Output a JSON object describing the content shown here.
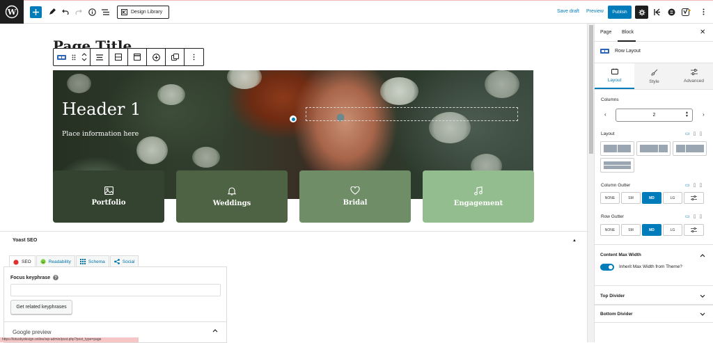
{
  "topbar": {
    "design_library_label": "Design Library",
    "save_draft_label": "Save draft",
    "preview_label": "Preview",
    "publish_label": "Publish"
  },
  "canvas": {
    "post_title": "Page Title",
    "hero": {
      "heading": "Header 1",
      "text": "Place information here"
    },
    "cards": [
      {
        "label": "Portfolio",
        "icon": "image-icon",
        "color": "#344330"
      },
      {
        "label": "Weddings",
        "icon": "bell-icon",
        "color": "#4d6343"
      },
      {
        "label": "Bridal",
        "icon": "heart-icon",
        "color": "#6f8d67"
      },
      {
        "label": "Engagement",
        "icon": "music-note-icon",
        "color": "#93bd8e"
      }
    ]
  },
  "yoast": {
    "title": "Yoast SEO",
    "tabs": [
      "SEO",
      "Readability",
      "Schema",
      "Social"
    ],
    "focus_keyphrase_label": "Focus keyphrase",
    "related_button": "Get related keyphrases",
    "google_preview": "Google preview"
  },
  "status_url": "https://lotusbydesign.online/wp-admin/post.php?post_type=page",
  "sidebar": {
    "tabs": [
      "Page",
      "Block"
    ],
    "block_name": "Row Layout",
    "subtabs": [
      "Layout",
      "Style",
      "Advanced"
    ],
    "columns_label": "Columns",
    "columns_value": "2",
    "layout_label": "Layout",
    "column_gutter_label": "Column Gutter",
    "row_gutter_label": "Row Gutter",
    "gutter_options": [
      "NONE",
      "SM",
      "MD",
      "LG"
    ],
    "gutter_selected": "MD",
    "content_max_width": "Content Max Width",
    "inherit_max_width": "Inherit Max Width from Theme?",
    "top_divider": "Top Divider",
    "bottom_divider": "Bottom Divider"
  },
  "colors": {
    "accent": "#007cba",
    "card_portfolio": "#344330",
    "card_weddings": "#4d6343",
    "card_bridal": "#6f8d67",
    "card_engagement": "#93bd8e"
  }
}
